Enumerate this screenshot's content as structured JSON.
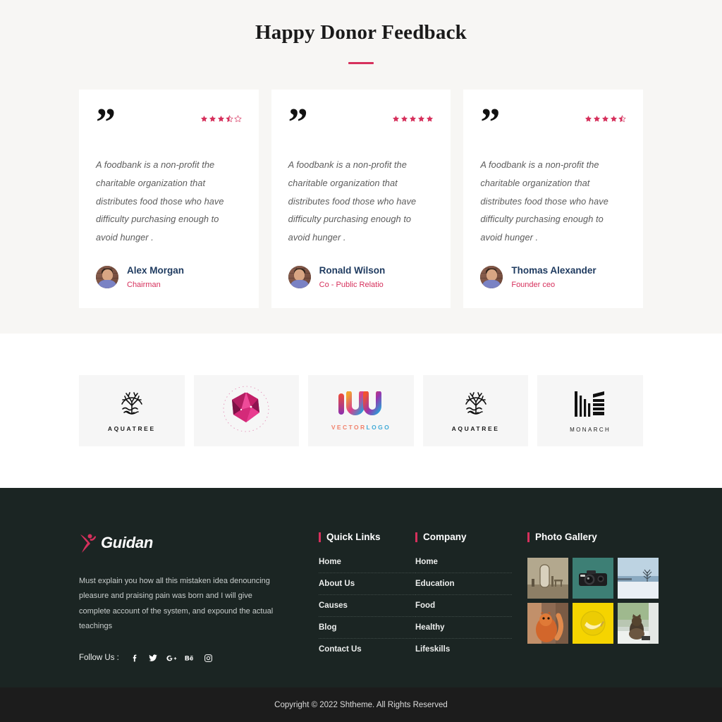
{
  "testimonials_section": {
    "title": "Happy Donor Feedback",
    "cards": [
      {
        "quote_mark": "”",
        "rating": 3.5,
        "text": "A foodbank is a non-profit the charitable organization that distributes food those who have difficulty purchasing enough to avoid hunger .",
        "author_name": "Alex Morgan",
        "author_role": "Chairman",
        "avatar": "avatar-man-brick-wall"
      },
      {
        "quote_mark": "”",
        "rating": 5,
        "text": "A foodbank is a non-profit the charitable organization that distributes food those who have difficulty purchasing enough to avoid hunger .",
        "author_name": "Ronald Wilson",
        "author_role": "Co - Public Relatio",
        "avatar": "avatar-man-brick-wall"
      },
      {
        "quote_mark": "”",
        "rating": 4.5,
        "text": "A foodbank is a non-profit the charitable organization that distributes food those who have difficulty purchasing enough to avoid hunger .",
        "author_name": "Thomas Alexander",
        "author_role": "Founder ceo",
        "avatar": "avatar-man-brick-wall"
      }
    ]
  },
  "partners": [
    {
      "icon": "aquatree-tree-icon",
      "word": "AQUATREE",
      "style": "mono"
    },
    {
      "icon": "polygon-gem-icon",
      "word": "",
      "style": "gem"
    },
    {
      "icon": "iuu-wave-icon",
      "word_a": "VECTOR",
      "word_b": "LOGO",
      "style": "vectorlogo"
    },
    {
      "icon": "aquatree-tree-icon",
      "word": "AQUATREE",
      "style": "mono"
    },
    {
      "icon": "monarch-bars-icon",
      "word": "MONARCH",
      "style": "monarch"
    }
  ],
  "footer": {
    "brand": {
      "name": "Guidan",
      "logo_icon": "guidan-figure-icon",
      "description": "Must explain you how all this mistaken idea denouncing pleasure and praising pain was born and I will give complete account of the system, and expound the actual teachings",
      "follow_label": "Follow Us :",
      "socials": [
        {
          "name": "facebook-icon",
          "glyph": "f"
        },
        {
          "name": "twitter-icon",
          "glyph": "t"
        },
        {
          "name": "google-plus-icon",
          "glyph": "g"
        },
        {
          "name": "behance-icon",
          "glyph": "b"
        },
        {
          "name": "instagram-icon",
          "glyph": "i"
        }
      ]
    },
    "quick_links": {
      "title": "Quick Links",
      "items": [
        "Home",
        "About Us",
        "Causes",
        "Blog",
        "Contact Us"
      ]
    },
    "company": {
      "title": "Company",
      "items": [
        "Home",
        "Education",
        "Food",
        "Healthy",
        "Lifeskills"
      ]
    },
    "gallery": {
      "title": "Photo Gallery",
      "items": [
        {
          "name": "thumb-interior-mirror"
        },
        {
          "name": "thumb-camera-teal"
        },
        {
          "name": "thumb-snow-tree"
        },
        {
          "name": "thumb-squirrel"
        },
        {
          "name": "thumb-banana-yellow"
        },
        {
          "name": "thumb-cat-window"
        }
      ]
    }
  },
  "copyright": {
    "text": "Copyright © 2022 Shtheme. All Rights Reserved"
  },
  "colors": {
    "accent": "#d6305c",
    "section_bg": "#f7f6f4",
    "footer_bg": "#1b2523",
    "copyright_bg": "#1c1c1c",
    "author_name": "#1e3a5f"
  }
}
